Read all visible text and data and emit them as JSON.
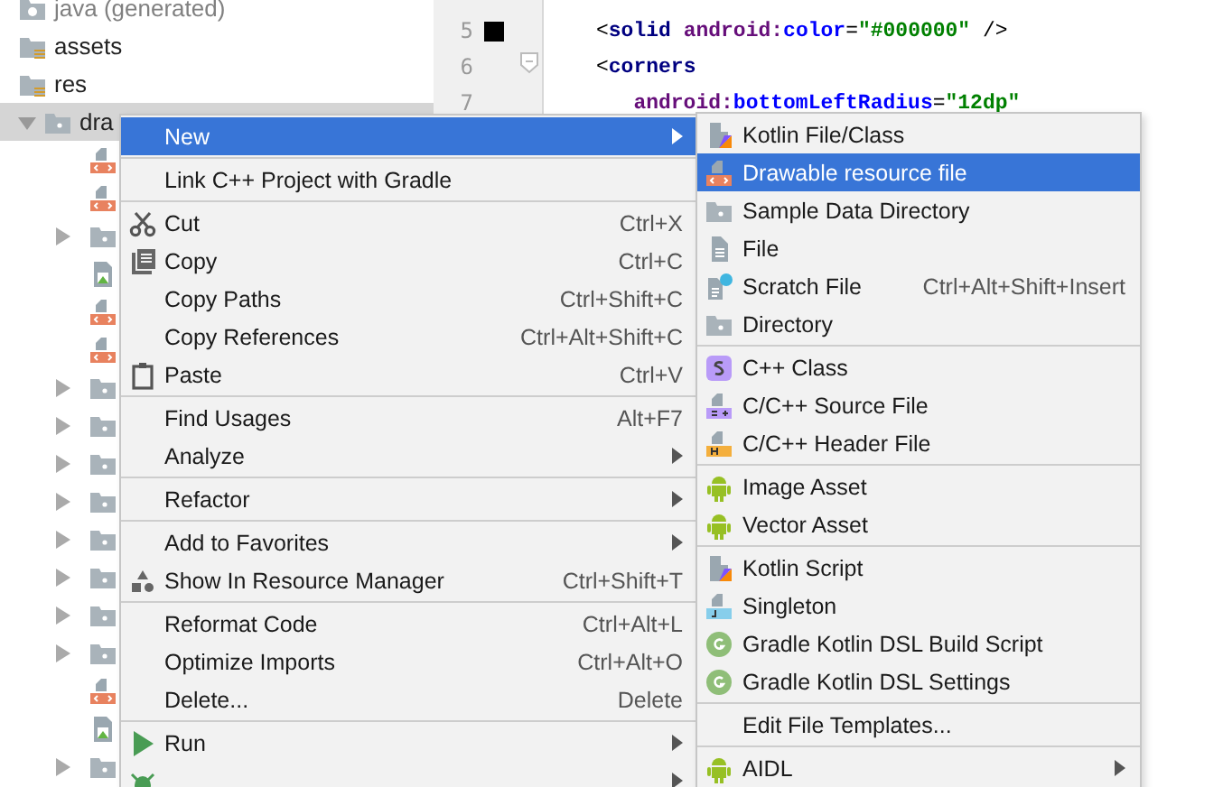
{
  "project_tree": [
    {
      "label": "java (generated)",
      "kind": "java",
      "selected": false
    },
    {
      "label": "assets",
      "kind": "assets",
      "selected": false
    },
    {
      "label": "res",
      "kind": "res",
      "selected": false
    },
    {
      "label": "dra",
      "kind": "folder",
      "selected": true,
      "expanded": true,
      "children": [
        {
          "kind": "xml",
          "selected": false
        },
        {
          "kind": "xml",
          "selected": false
        },
        {
          "kind": "folder",
          "selected": false,
          "expanded": false
        },
        {
          "kind": "image",
          "selected": false
        },
        {
          "kind": "xml",
          "selected": false
        },
        {
          "kind": "xml",
          "selected": false
        },
        {
          "kind": "folder",
          "selected": false,
          "expanded": false
        },
        {
          "kind": "folder",
          "selected": false,
          "expanded": false
        },
        {
          "kind": "folder",
          "selected": false,
          "expanded": false
        },
        {
          "kind": "folder",
          "selected": false,
          "expanded": false
        },
        {
          "kind": "folder",
          "selected": false,
          "expanded": false
        },
        {
          "kind": "folder",
          "selected": false,
          "expanded": false
        },
        {
          "kind": "folder",
          "selected": false,
          "expanded": false
        },
        {
          "kind": "folder",
          "selected": false,
          "expanded": false
        },
        {
          "kind": "xml",
          "selected": false
        },
        {
          "kind": "image",
          "selected": false
        },
        {
          "kind": "folder",
          "selected": false,
          "expanded": false
        }
      ]
    }
  ],
  "editor": {
    "lines": [
      {
        "number": "5",
        "kind": "swatch",
        "tokens": [
          {
            "kind": "punct",
            "text": "<"
          },
          {
            "kind": "tag",
            "text": "solid "
          },
          {
            "kind": "ns",
            "text": "android:"
          },
          {
            "kind": "attr",
            "text": "color"
          },
          {
            "kind": "punct",
            "text": "="
          },
          {
            "kind": "value",
            "text": "\"#000000\""
          },
          {
            "kind": "punct",
            "text": " />"
          }
        ]
      },
      {
        "number": "6",
        "kind": "fold",
        "tokens": [
          {
            "kind": "punct",
            "text": "<"
          },
          {
            "kind": "tag",
            "text": "corners"
          }
        ]
      },
      {
        "number": "7",
        "kind": "plain",
        "tokens": [
          {
            "kind": "ns",
            "text": "   android:"
          },
          {
            "kind": "attr",
            "text": "bottomLeftRadius"
          },
          {
            "kind": "punct",
            "text": "="
          },
          {
            "kind": "value",
            "text": "\"12dp\""
          }
        ]
      }
    ]
  },
  "context_menu": {
    "groups": [
      {
        "items": [
          {
            "label": "New",
            "kind": "plain",
            "submenu": true,
            "selected": true
          }
        ]
      },
      {
        "items": [
          {
            "label": "Link C++ Project with Gradle",
            "kind": "plain",
            "submenu": false,
            "selected": false
          }
        ]
      },
      {
        "items": [
          {
            "label": "Cut",
            "kind": "cut",
            "shortcut": "Ctrl+X",
            "submenu": false,
            "selected": false
          },
          {
            "label": "Copy",
            "kind": "copy",
            "shortcut": "Ctrl+C",
            "submenu": false,
            "selected": false
          },
          {
            "label": "Copy Paths",
            "kind": "plain",
            "shortcut": "Ctrl+Shift+C",
            "submenu": false,
            "selected": false
          },
          {
            "label": "Copy References",
            "kind": "plain",
            "shortcut": "Ctrl+Alt+Shift+C",
            "submenu": false,
            "selected": false
          },
          {
            "label": "Paste",
            "kind": "paste",
            "shortcut": "Ctrl+V",
            "submenu": false,
            "selected": false
          }
        ]
      },
      {
        "items": [
          {
            "label": "Find Usages",
            "kind": "plain",
            "shortcut": "Alt+F7",
            "submenu": false,
            "selected": false
          },
          {
            "label": "Analyze",
            "kind": "plain",
            "submenu": true,
            "selected": false
          }
        ]
      },
      {
        "items": [
          {
            "label": "Refactor",
            "kind": "plain",
            "submenu": true,
            "selected": false
          }
        ]
      },
      {
        "items": [
          {
            "label": "Add to Favorites",
            "kind": "plain",
            "submenu": true,
            "selected": false
          },
          {
            "label": "Show In Resource Manager",
            "kind": "shapes",
            "shortcut": "Ctrl+Shift+T",
            "submenu": false,
            "selected": false
          }
        ]
      },
      {
        "items": [
          {
            "label": "Reformat Code",
            "kind": "plain",
            "shortcut": "Ctrl+Alt+L",
            "submenu": false,
            "selected": false
          },
          {
            "label": "Optimize Imports",
            "kind": "plain",
            "shortcut": "Ctrl+Alt+O",
            "submenu": false,
            "selected": false
          },
          {
            "label": "Delete...",
            "kind": "plain",
            "shortcut": "Delete",
            "submenu": false,
            "selected": false
          }
        ]
      },
      {
        "items": [
          {
            "label": "Run",
            "kind": "run",
            "submenu": true,
            "selected": false
          },
          {
            "kind": "debug",
            "submenu": true,
            "selected": false
          }
        ]
      }
    ]
  },
  "new_submenu": {
    "groups": [
      {
        "items": [
          {
            "label": "Kotlin File/Class",
            "kind": "kotlin",
            "selected": false
          },
          {
            "label": "Drawable resource file",
            "kind": "xml",
            "selected": true
          },
          {
            "label": "Sample Data Directory",
            "kind": "folder",
            "selected": false
          },
          {
            "label": "File",
            "kind": "file",
            "selected": false
          },
          {
            "label": "Scratch File",
            "kind": "scratch",
            "shortcut": "Ctrl+Alt+Shift+Insert",
            "selected": false
          },
          {
            "label": "Directory",
            "kind": "folder",
            "selected": false
          }
        ]
      },
      {
        "items": [
          {
            "label": "C++ Class",
            "kind": "cppclass",
            "selected": false
          },
          {
            "label": "C/C++ Source File",
            "kind": "cppsource",
            "selected": false
          },
          {
            "label": "C/C++ Header File",
            "kind": "cppheader",
            "selected": false
          }
        ]
      },
      {
        "items": [
          {
            "label": "Image Asset",
            "kind": "android",
            "selected": false
          },
          {
            "label": "Vector Asset",
            "kind": "android",
            "selected": false
          }
        ]
      },
      {
        "items": [
          {
            "label": "Kotlin Script",
            "kind": "kotlinscript",
            "selected": false
          },
          {
            "label": "Singleton",
            "kind": "singleton",
            "selected": false
          },
          {
            "label": "Gradle Kotlin DSL Build Script",
            "kind": "gradle",
            "selected": false
          },
          {
            "label": "Gradle Kotlin DSL Settings",
            "kind": "gradle",
            "selected": false
          }
        ]
      },
      {
        "items": [
          {
            "label": "Edit File Templates...",
            "kind": "plain",
            "selected": false
          }
        ]
      },
      {
        "items": [
          {
            "label": "AIDL",
            "kind": "android",
            "submenu": true,
            "selected": false
          }
        ]
      }
    ]
  }
}
